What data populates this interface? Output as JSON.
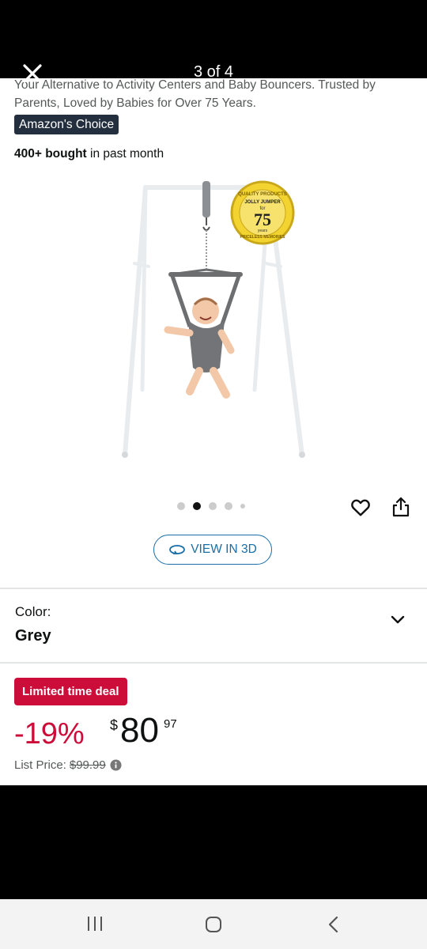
{
  "header": {
    "counter": "3 of 4"
  },
  "product": {
    "subtitle": "Your Alternative to Activity Centers and Baby Bouncers. Trusted by Parents, Loved by Babies for Over 75 Years.",
    "badge": "Amazon's Choice",
    "bought_bold": "400+ bought",
    "bought_rest": " in past month",
    "seal": {
      "top": "QUALITY PRODUCTS",
      "brand": "JOLLY JUMPER",
      "for": "for",
      "number": "75",
      "years": "years",
      "bottom": "PRICELESS MEMORIES"
    }
  },
  "gallery": {
    "dots": 5,
    "active_index": 1,
    "view3d_label": "VIEW IN 3D"
  },
  "variant": {
    "label": "Color:",
    "value": "Grey"
  },
  "pricing": {
    "deal_label": "Limited time deal",
    "discount": "-19%",
    "currency": "$",
    "whole": "80",
    "fraction": "97",
    "list_label": "List Price:",
    "list_value": "$99.99"
  },
  "icons": {
    "close": "close-icon",
    "heart": "heart-icon",
    "share": "share-icon",
    "view3d": "rotate-3d-icon",
    "chevron": "chevron-down-icon",
    "info": "info-icon",
    "recent": "recent-apps-icon",
    "home": "home-icon",
    "back": "back-icon"
  },
  "colors": {
    "deal_red": "#cc0c39",
    "badge_navy": "#232f3e",
    "link_blue": "#1a6ea8",
    "seal_gold": "#f2d330"
  }
}
